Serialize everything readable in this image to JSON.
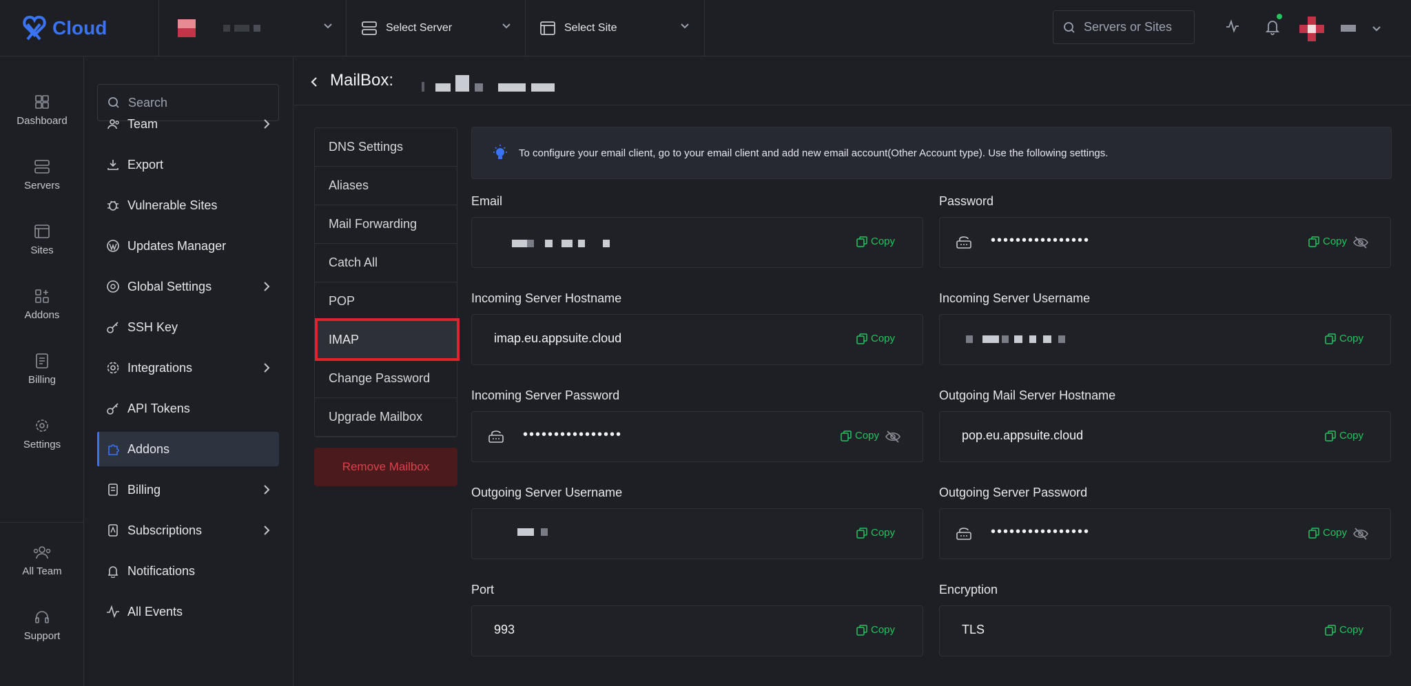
{
  "app": {
    "logo_text": "Cloud"
  },
  "topbar": {
    "server_select": "Select Server",
    "site_select": "Select Site",
    "search_placeholder": "Servers or Sites"
  },
  "rail": {
    "items": [
      "Dashboard",
      "Servers",
      "Sites",
      "Addons",
      "Billing",
      "Settings"
    ],
    "bottom": [
      "All Team",
      "Support"
    ]
  },
  "sidebar": {
    "search_placeholder": "Search",
    "items": [
      {
        "label": "Team",
        "icon": "team-icon",
        "arrow": true
      },
      {
        "label": "Export",
        "icon": "download-icon",
        "arrow": false
      },
      {
        "label": "Vulnerable Sites",
        "icon": "bug-icon",
        "arrow": false
      },
      {
        "label": "Updates Manager",
        "icon": "wordpress-icon",
        "arrow": false
      },
      {
        "label": "Global Settings",
        "icon": "globe-icon",
        "arrow": true
      },
      {
        "label": "SSH Key",
        "icon": "key-icon",
        "arrow": false
      },
      {
        "label": "Integrations",
        "icon": "gear-icon",
        "arrow": true
      },
      {
        "label": "API Tokens",
        "icon": "key-icon",
        "arrow": false
      },
      {
        "label": "Addons",
        "icon": "puzzle-icon",
        "arrow": false,
        "active": true
      },
      {
        "label": "Billing",
        "icon": "billing-icon",
        "arrow": true
      },
      {
        "label": "Subscriptions",
        "icon": "subscription-icon",
        "arrow": true
      },
      {
        "label": "Notifications",
        "icon": "bell-icon",
        "arrow": false
      },
      {
        "label": "All Events",
        "icon": "activity-icon",
        "arrow": false
      }
    ]
  },
  "page": {
    "title": "MailBox:"
  },
  "tabs": [
    "DNS Settings",
    "Aliases",
    "Mail Forwarding",
    "Catch All",
    "POP",
    "IMAP",
    "Change Password",
    "Upgrade Mailbox"
  ],
  "active_tab": "IMAP",
  "remove_button": "Remove Mailbox",
  "info": "To configure your email client, go to your email client and add new email account(Other Account type). Use the following settings.",
  "copy_label": "Copy",
  "fields": {
    "email": {
      "label": "Email",
      "value": ""
    },
    "password": {
      "label": "Password",
      "value": "••••••••••••••••"
    },
    "incoming_hostname": {
      "label": "Incoming Server Hostname",
      "value": "imap.eu.appsuite.cloud"
    },
    "incoming_username": {
      "label": "Incoming Server Username",
      "value": ""
    },
    "incoming_password": {
      "label": "Incoming Server Password",
      "value": "••••••••••••••••"
    },
    "outgoing_hostname": {
      "label": "Outgoing Mail Server Hostname",
      "value": "pop.eu.appsuite.cloud"
    },
    "outgoing_username": {
      "label": "Outgoing Server Username",
      "value": ""
    },
    "outgoing_password": {
      "label": "Outgoing Server Password",
      "value": "••••••••••••••••"
    },
    "port": {
      "label": "Port",
      "value": "993"
    },
    "encryption": {
      "label": "Encryption",
      "value": "TLS"
    }
  },
  "colors": {
    "accent": "#3a73f6",
    "success": "#22c55e",
    "danger": "#d9434b",
    "highlight": "#e0232c"
  }
}
